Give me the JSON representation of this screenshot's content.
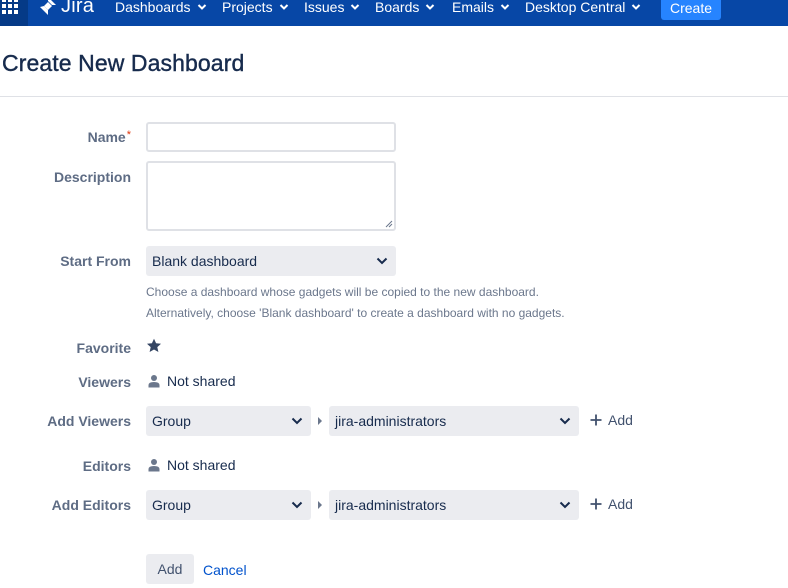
{
  "topbar": {
    "logo_text": "Jira",
    "nav": [
      {
        "label": "Dashboards"
      },
      {
        "label": "Projects"
      },
      {
        "label": "Issues"
      },
      {
        "label": "Boards"
      },
      {
        "label": "Emails"
      },
      {
        "label": "Desktop Central"
      }
    ],
    "create_label": "Create"
  },
  "page": {
    "title": "Create New Dashboard"
  },
  "form": {
    "name_label": "Name",
    "required_mark": "*",
    "name_value": "",
    "description_label": "Description",
    "description_value": "",
    "start_from_label": "Start From",
    "start_from_value": "Blank dashboard",
    "start_from_help_1": "Choose a dashboard whose gadgets will be copied to the new dashboard.",
    "start_from_help_2": "Alternatively, choose 'Blank dashboard' to create a dashboard with no gadgets.",
    "favorite_label": "Favorite",
    "viewers_label": "Viewers",
    "viewers_value": "Not shared",
    "add_viewers_label": "Add Viewers",
    "add_viewers_type": "Group",
    "add_viewers_group": "jira-administrators",
    "add_viewers_action": "Add",
    "editors_label": "Editors",
    "editors_value": "Not shared",
    "add_editors_label": "Add Editors",
    "add_editors_type": "Group",
    "add_editors_group": "jira-administrators",
    "add_editors_action": "Add",
    "submit_label": "Add",
    "cancel_label": "Cancel"
  },
  "colors": {
    "topbar": "#0747a6",
    "create_button": "#2684ff",
    "link": "#0052cc",
    "required": "#de350b"
  },
  "icons": {
    "app_switcher": "grid-icon",
    "logo": "jira-logo-icon",
    "dropdown": "chevron-down-icon",
    "favorite": "star-icon",
    "person": "person-icon",
    "add": "plus-icon",
    "separator": "caret-right-icon"
  }
}
